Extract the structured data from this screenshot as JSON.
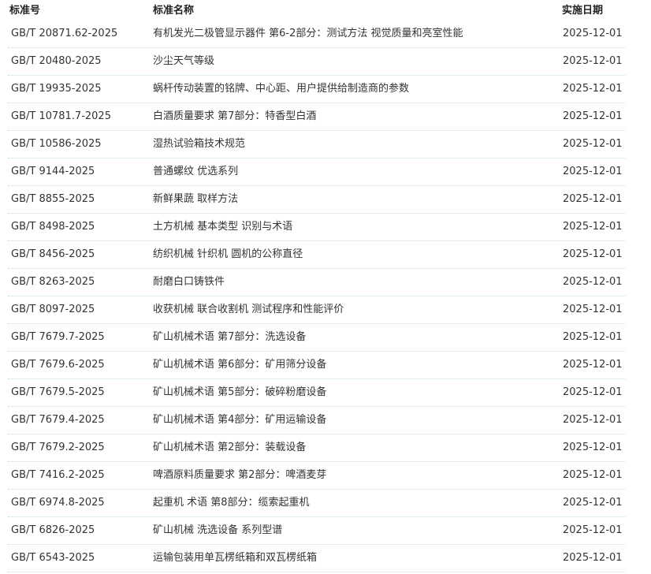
{
  "headers": {
    "code": "标准号",
    "name": "标准名称",
    "date": "实施日期"
  },
  "rows": [
    {
      "code": "GB/T 20871.62-2025",
      "name": "有机发光二极管显示器件 第6-2部分：测试方法 视觉质量和亮室性能",
      "date": "2025-12-01"
    },
    {
      "code": "GB/T 20480-2025",
      "name": "沙尘天气等级",
      "date": "2025-12-01"
    },
    {
      "code": "GB/T 19935-2025",
      "name": "蜗杆传动装置的铭牌、中心距、用户提供给制造商的参数",
      "date": "2025-12-01"
    },
    {
      "code": "GB/T 10781.7-2025",
      "name": "白酒质量要求 第7部分：特香型白酒",
      "date": "2025-12-01"
    },
    {
      "code": "GB/T 10586-2025",
      "name": "湿热试验箱技术规范",
      "date": "2025-12-01"
    },
    {
      "code": "GB/T 9144-2025",
      "name": "普通螺纹 优选系列",
      "date": "2025-12-01"
    },
    {
      "code": "GB/T 8855-2025",
      "name": "新鲜果蔬 取样方法",
      "date": "2025-12-01"
    },
    {
      "code": "GB/T 8498-2025",
      "name": "土方机械 基本类型 识别与术语",
      "date": "2025-12-01"
    },
    {
      "code": "GB/T 8456-2025",
      "name": "纺织机械 针织机 圆机的公称直径",
      "date": "2025-12-01"
    },
    {
      "code": "GB/T 8263-2025",
      "name": "耐磨白口铸铁件",
      "date": "2025-12-01"
    },
    {
      "code": "GB/T 8097-2025",
      "name": "收获机械 联合收割机 测试程序和性能评价",
      "date": "2025-12-01"
    },
    {
      "code": "GB/T 7679.7-2025",
      "name": "矿山机械术语 第7部分：洗选设备",
      "date": "2025-12-01"
    },
    {
      "code": "GB/T 7679.6-2025",
      "name": "矿山机械术语 第6部分：矿用筛分设备",
      "date": "2025-12-01"
    },
    {
      "code": "GB/T 7679.5-2025",
      "name": "矿山机械术语 第5部分：破碎粉磨设备",
      "date": "2025-12-01"
    },
    {
      "code": "GB/T 7679.4-2025",
      "name": "矿山机械术语 第4部分：矿用运输设备",
      "date": "2025-12-01"
    },
    {
      "code": "GB/T 7679.2-2025",
      "name": "矿山机械术语 第2部分：装载设备",
      "date": "2025-12-01"
    },
    {
      "code": "GB/T 7416.2-2025",
      "name": "啤酒原料质量要求 第2部分：啤酒麦芽",
      "date": "2025-12-01"
    },
    {
      "code": "GB/T 6974.8-2025",
      "name": "起重机 术语 第8部分：缆索起重机",
      "date": "2025-12-01"
    },
    {
      "code": "GB/T 6826-2025",
      "name": "矿山机械 洗选设备 系列型谱",
      "date": "2025-12-01"
    },
    {
      "code": "GB/T 6543-2025",
      "name": "运输包装用单瓦楞纸箱和双瓦楞纸箱",
      "date": "2025-12-01"
    }
  ]
}
